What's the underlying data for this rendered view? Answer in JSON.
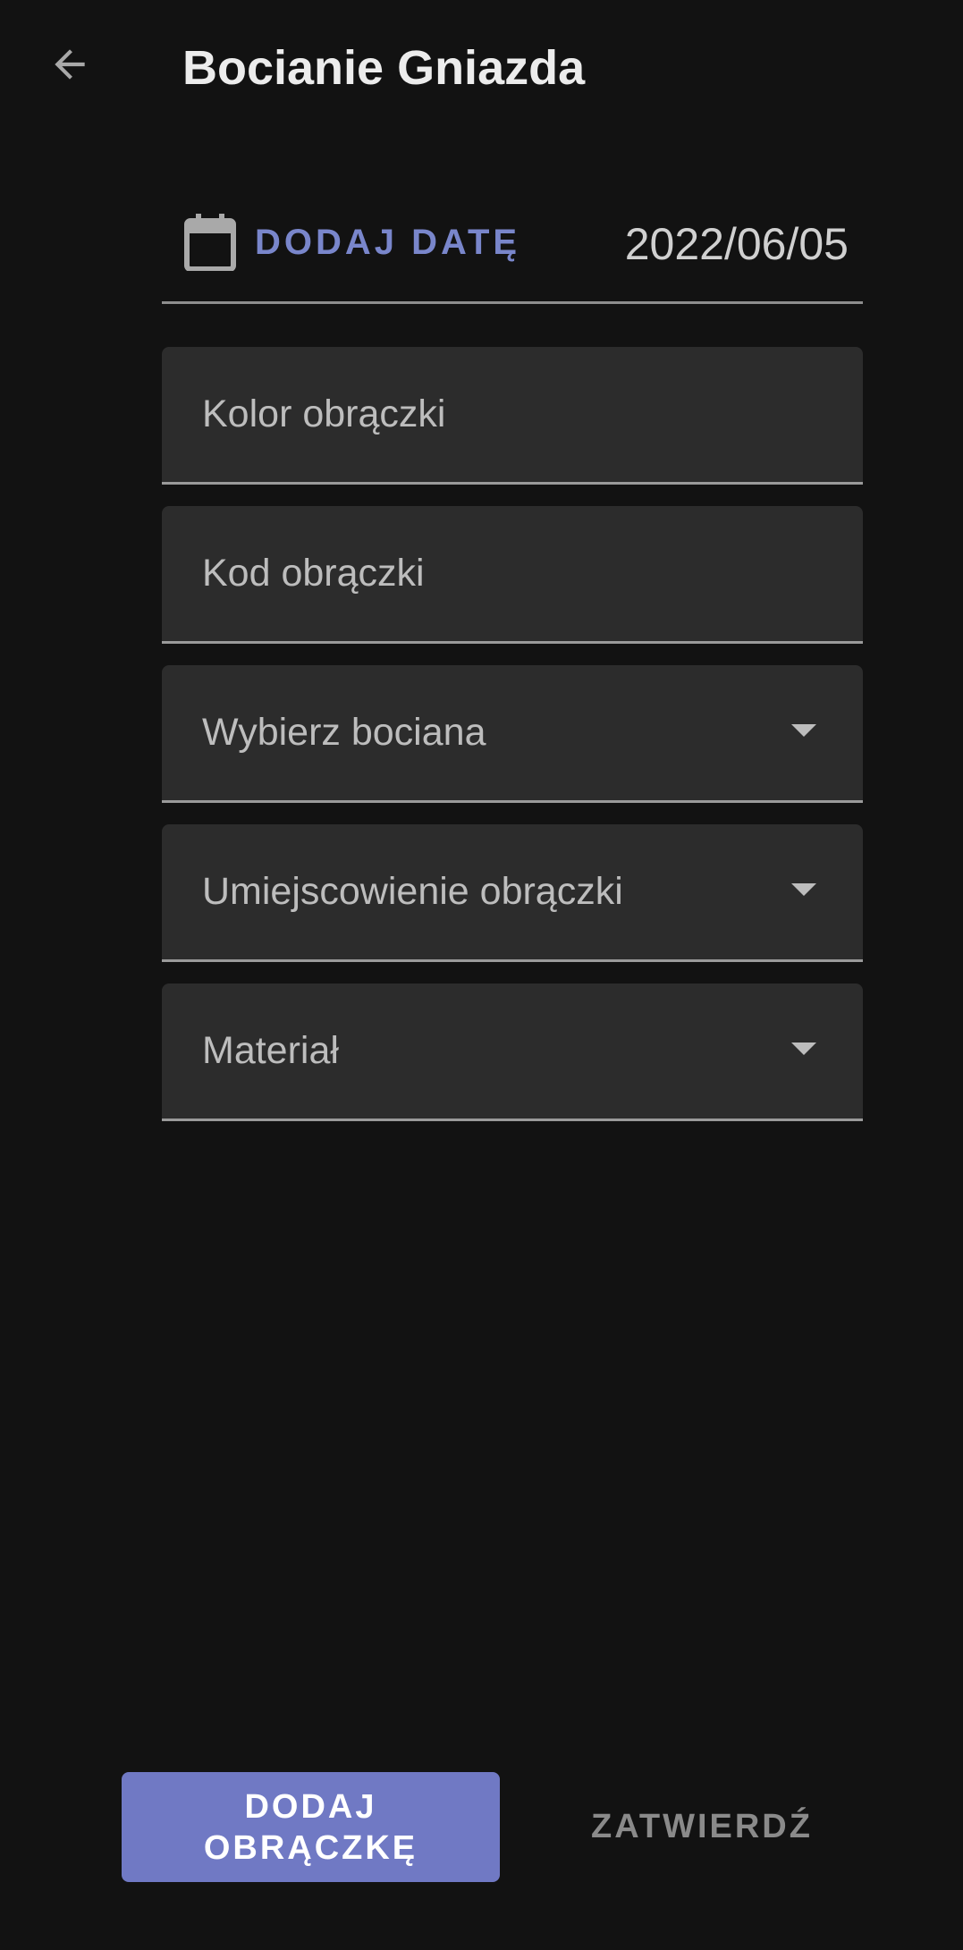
{
  "app_bar": {
    "back_icon": "arrow-left-icon",
    "title": "Bocianie Gniazda"
  },
  "date_row": {
    "icon": "calendar-icon",
    "button_label": "DODAJ DATĘ",
    "value": "2022/06/05"
  },
  "fields": [
    {
      "label": "Kolor obrączki",
      "type": "text"
    },
    {
      "label": "Kod obrączki",
      "type": "text"
    },
    {
      "label": "Wybierz bociana",
      "type": "select"
    },
    {
      "label": "Umiejscowienie obrączki",
      "type": "select"
    },
    {
      "label": "Materiał",
      "type": "select"
    }
  ],
  "actions": {
    "primary_label": "DODAJ OBRĄCZKĘ",
    "secondary_label": "ZATWIERDŹ"
  },
  "colors": {
    "background": "#121212",
    "field_background": "#2c2c2c",
    "accent": "#7986cb",
    "primary_button": "#7079c4"
  }
}
